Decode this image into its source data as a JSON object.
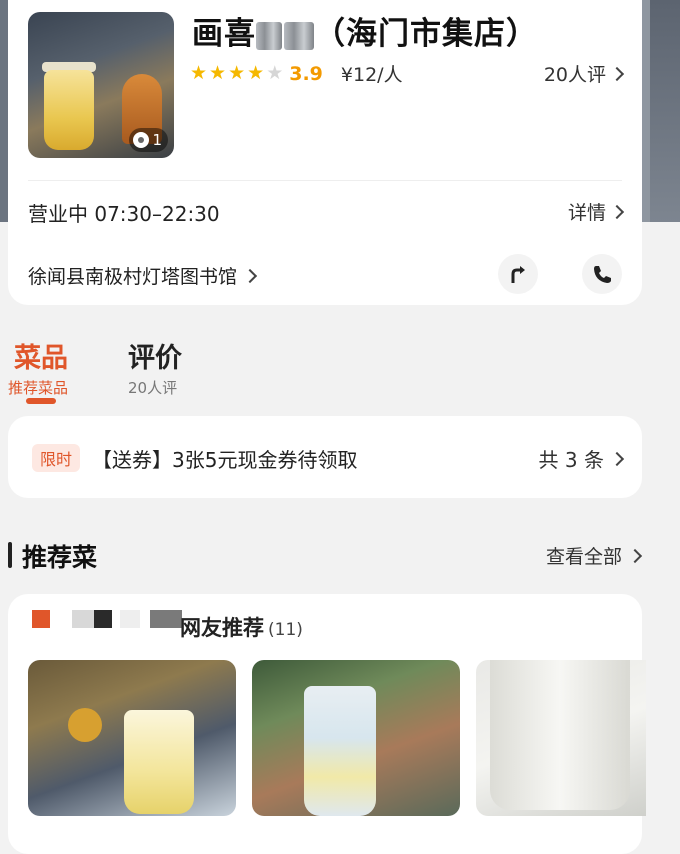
{
  "shop": {
    "title_prefix": "画喜",
    "title_suffix": "（海门市集店）",
    "rating": {
      "stars_filled": 4,
      "stars_total": 5,
      "score": "3.9"
    },
    "price": "¥12/人",
    "review_link": "20人评",
    "photo_count": "1",
    "status_hours": "营业中 07:30–22:30",
    "details_label": "详情",
    "address": "徐闻县南极村灯塔图书馆",
    "icons": {
      "navigate": "navigate-icon",
      "phone": "phone-icon",
      "camera": "camera-icon"
    }
  },
  "tabs": [
    {
      "label": "菜品",
      "sub": "推荐菜品",
      "active": true
    },
    {
      "label": "评价",
      "sub": "20人评",
      "active": false
    }
  ],
  "coupon": {
    "badge": "限时",
    "text": "【送券】3张5元现金券待领取",
    "count": "共 3 条"
  },
  "section": {
    "title": "推荐菜",
    "view_all": "查看全部"
  },
  "dishes": {
    "label": "网友推荐",
    "count": "(11)"
  },
  "colors": {
    "accent": "#e0562a",
    "star": "#f5b800",
    "score": "#f39a00"
  }
}
